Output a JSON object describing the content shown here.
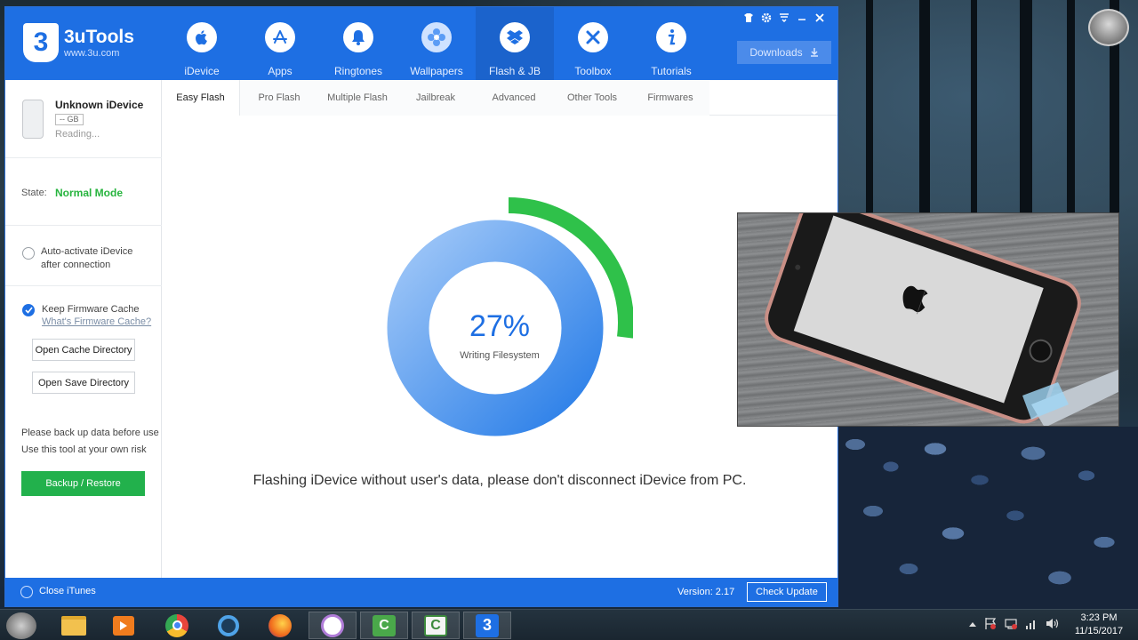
{
  "app": {
    "name": "3uTools",
    "url": "www.3u.com",
    "logo_glyph": "3"
  },
  "nav": [
    {
      "label": "iDevice",
      "icon": "apple-icon"
    },
    {
      "label": "Apps",
      "icon": "app-store-icon"
    },
    {
      "label": "Ringtones",
      "icon": "bell-icon"
    },
    {
      "label": "Wallpapers",
      "icon": "flower-icon"
    },
    {
      "label": "Flash & JB",
      "icon": "dropbox-box-icon",
      "active": true
    },
    {
      "label": "Toolbox",
      "icon": "tools-icon"
    },
    {
      "label": "Tutorials",
      "icon": "info-icon"
    }
  ],
  "header": {
    "downloads_label": "Downloads"
  },
  "device": {
    "name": "Unknown iDevice",
    "capacity": "-- GB",
    "status": "Reading..."
  },
  "state": {
    "label": "State:",
    "value": "Normal Mode"
  },
  "options": {
    "auto_activate": "Auto-activate iDevice after connection",
    "keep_cache": "Keep Firmware Cache",
    "cache_link": "What's Firmware Cache?",
    "open_cache": "Open Cache Directory",
    "open_save": "Open Save Directory"
  },
  "warning": {
    "line1": "Please back up data before use",
    "line2": "Use this tool at your own risk"
  },
  "backup_label": "Backup / Restore",
  "tabs": [
    {
      "label": "Easy Flash",
      "active": true
    },
    {
      "label": "Pro Flash"
    },
    {
      "label": "Multiple Flash"
    },
    {
      "label": "Jailbreak"
    },
    {
      "label": "Advanced"
    },
    {
      "label": "Other Tools"
    },
    {
      "label": "Firmwares"
    }
  ],
  "progress": {
    "percent_text": "27%",
    "percent": 27,
    "label": "Writing Filesystem"
  },
  "notice": "Flashing iDevice without user's data, please don't disconnect iDevice from PC.",
  "footer": {
    "close_itunes": "Close iTunes",
    "version": "Version: 2.17",
    "check_update": "Check Update"
  },
  "clock": {
    "time": "3:23 PM",
    "date": "11/15/2017"
  },
  "colors": {
    "brand_blue": "#1e6fe3",
    "success_green": "#27b43e",
    "progress_green": "#2fc14a"
  },
  "taskbar_icons": [
    "avatar-icon",
    "file-explorer-icon",
    "media-player-icon",
    "chrome-icon",
    "ie-icon",
    "firefox-icon",
    "itunes-icon",
    "camtasia-icon",
    "camtasia-recorder-icon",
    "3utools-icon"
  ]
}
